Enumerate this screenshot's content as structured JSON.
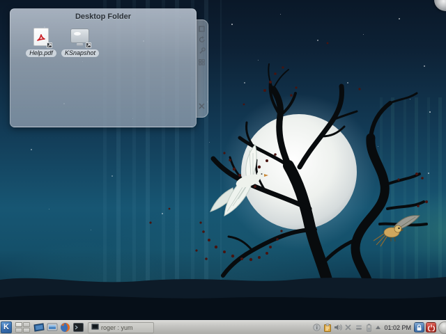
{
  "desktop": {
    "folder_widget": {
      "title": "Desktop Folder",
      "items": [
        {
          "label": "Help.pdf",
          "icon": "pdf-document-icon"
        },
        {
          "label": "KSnapshot",
          "icon": "ksnapshot-monitor-icon"
        }
      ],
      "handle_buttons": [
        "resize-icon",
        "rotate-icon",
        "configure-wrench-icon",
        "maximize-icon",
        "close-icon"
      ]
    },
    "toolbox_icon": "desktop-toolbox-cashew"
  },
  "panel": {
    "kmenu": {
      "icon": "kde-menu-icon",
      "glyph": "K"
    },
    "pager": {
      "desktops": 4,
      "active": 1
    },
    "launchers": [
      "show-desktop-icon",
      "computer-icon",
      "firefox-icon",
      "konsole-icon"
    ],
    "task": {
      "label": "roger : yum",
      "icon": "terminal-window-icon"
    },
    "tray_icons": [
      "notifier-icon",
      "klipper-clipboard-icon",
      "volume-icon",
      "input-x-icon",
      "network-icon",
      "battery-icon"
    ],
    "tray_expander": "tray-expander-arrow",
    "clock": {
      "time": "01:02 PM"
    },
    "session": [
      "lock-screen-icon",
      "leave-power-icon"
    ],
    "cashew": "panel-cashew"
  },
  "colors": {
    "kmenu_blue": "#3b74b8",
    "lock_blue": "#4e7fb7",
    "leave_red": "#c23b30",
    "panel_gray": "#c2c2bf",
    "widget_gray": "#9daab8",
    "sky_top": "#0a1828",
    "sky_mid": "#175673",
    "moon": "#eef1ee",
    "leaf_red": "#471410"
  }
}
